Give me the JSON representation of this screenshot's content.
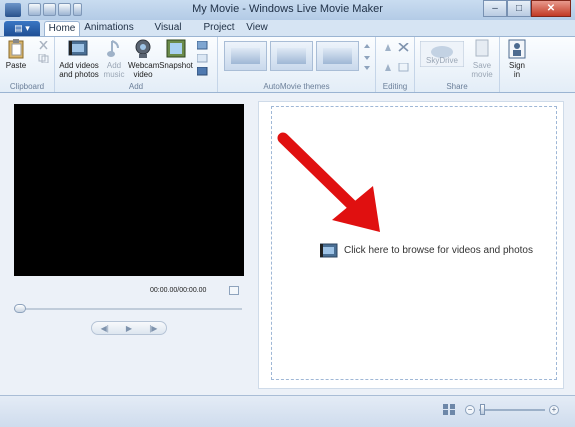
{
  "window": {
    "title": "My Movie - Windows Live Movie Maker",
    "controls": {
      "minimize": "–",
      "maximize": "□",
      "close": "✕"
    }
  },
  "tabs": [
    {
      "label": "Home",
      "active": true
    },
    {
      "label": "Animations",
      "active": false
    },
    {
      "label": "Visual Effects",
      "active": false
    },
    {
      "label": "Project",
      "active": false
    },
    {
      "label": "View",
      "active": false
    }
  ],
  "file_menu_icon": "file-menu-icon",
  "ribbon": {
    "clipboard": {
      "label": "Clipboard",
      "paste": "Paste"
    },
    "add": {
      "label": "Add",
      "add_videos_line1": "Add videos",
      "add_videos_line2": "and photos",
      "add_music_line1": "Add",
      "add_music_line2": "music",
      "webcam_line1": "Webcam",
      "webcam_line2": "video",
      "snapshot": "Snapshot"
    },
    "automovie": {
      "label": "AutoMovie themes"
    },
    "editing": {
      "label": "Editing"
    },
    "share": {
      "label": "Share",
      "skydrive": "SkyDrive",
      "save_line1": "Save",
      "save_line2": "movie"
    },
    "sign_in_line1": "Sign",
    "sign_in_line2": "in"
  },
  "preview": {
    "timecode": "00:00.00/00:00.00"
  },
  "storyboard": {
    "browse_text": "Click here to browse for videos and photos"
  },
  "colors": {
    "accent": "#1f4f95",
    "annotation_arrow": "#e01010"
  }
}
